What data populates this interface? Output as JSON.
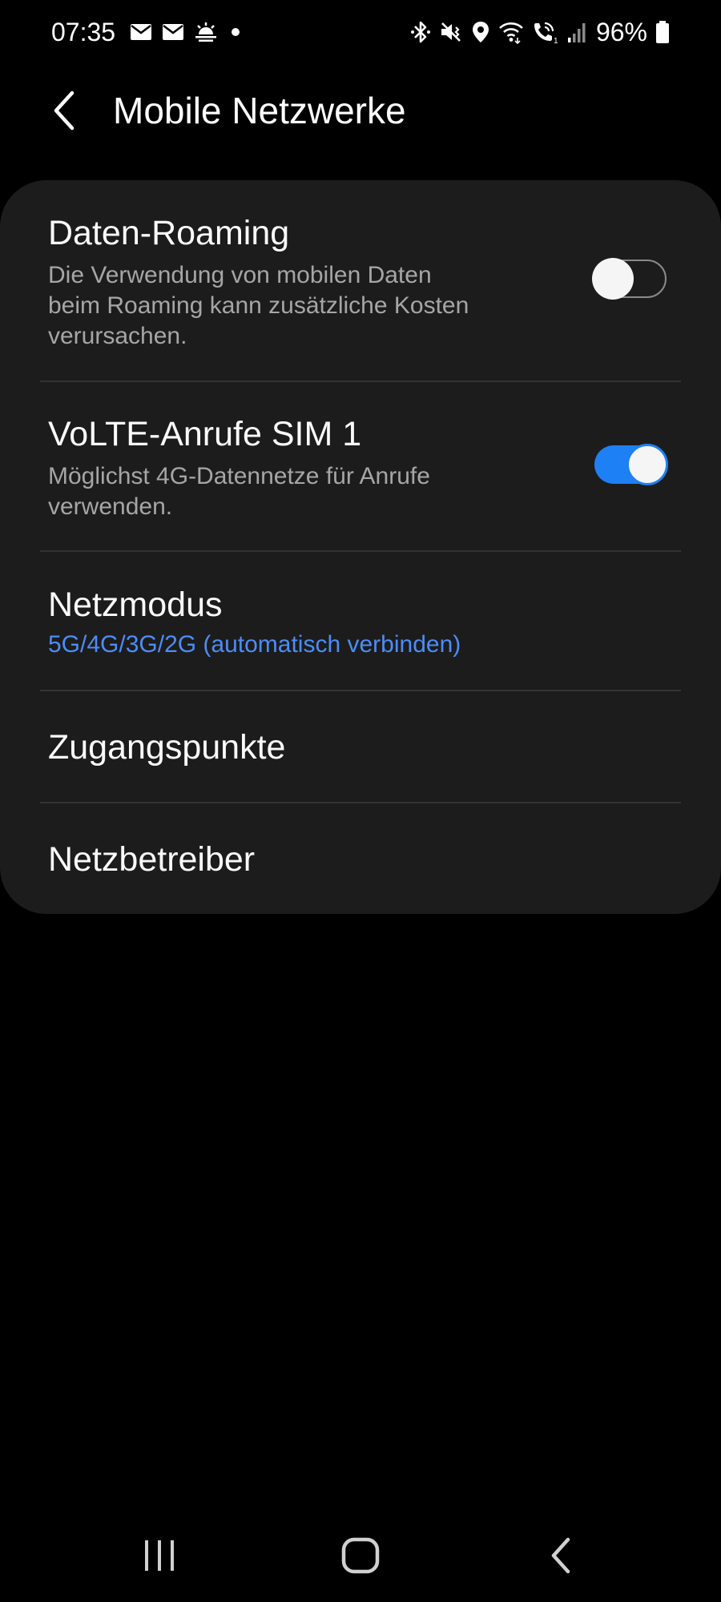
{
  "status_bar": {
    "time": "07:35",
    "battery": "96%",
    "left_icons": [
      "mail-icon",
      "mail-icon",
      "weather-sun-icon",
      "notification-dot-icon"
    ],
    "right_icons": [
      "bluetooth-icon",
      "mute-vibrate-icon",
      "location-icon",
      "wifi-icon",
      "volte-call-icon",
      "signal-icon",
      "battery-icon"
    ]
  },
  "header": {
    "title": "Mobile Netzwerke"
  },
  "settings": {
    "data_roaming": {
      "title": "Daten-Roaming",
      "subtitle_lines": [
        "Die Verwendung von mobilen Daten",
        "beim Roaming kann zusätzliche Kosten",
        "verursachen."
      ],
      "enabled": false
    },
    "volte": {
      "title": "VoLTE-Anrufe SIM 1",
      "subtitle_lines": [
        "Möglichst 4G-Datennetze für Anrufe",
        "verwenden."
      ],
      "enabled": true
    },
    "network_mode": {
      "title": "Netzmodus",
      "value": "5G/4G/3G/2G (automatisch verbinden)"
    },
    "access_points": {
      "title": "Zugangspunkte"
    },
    "network_operators": {
      "title": "Netzbetreiber"
    }
  },
  "colors": {
    "background": "#000000",
    "card": "#1c1c1c",
    "accent": "#1e80f5",
    "value_text": "#4c8df6",
    "secondary_text": "#a6a6a6"
  },
  "nav_bar": {
    "icons": [
      "recents-icon",
      "home-icon",
      "back-icon"
    ]
  }
}
